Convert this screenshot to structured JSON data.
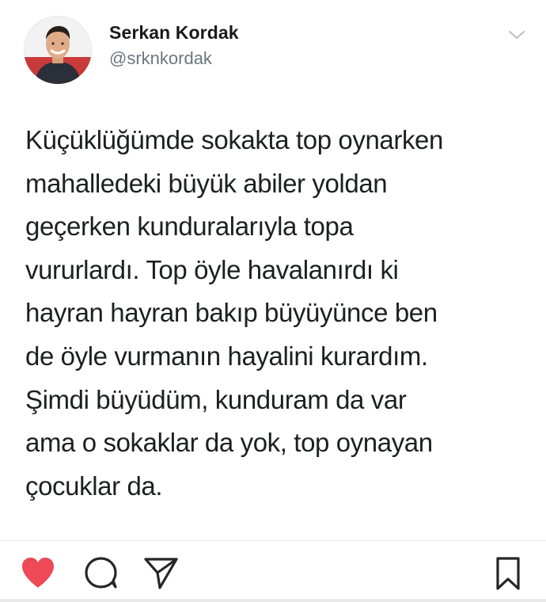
{
  "tweet": {
    "author": {
      "display_name": "Serkan Kordak",
      "handle": "@srknkordak"
    },
    "lines": [
      "Küçüklüğümde sokakta top oynarken",
      "mahalledeki büyük abiler yoldan",
      "geçerken kunduralarıyla topa",
      "vururlardı. Top öyle havalanırdı ki",
      "hayran hayran bakıp büyüyünce ben",
      "de öyle vurmanın hayalini kurardım.",
      "Şimdi büyüdüm, kunduram da var",
      "ama o sokaklar da yok, top oynayan",
      "çocuklar da."
    ]
  },
  "actions": {
    "like_icon": "heart-icon",
    "comment_icon": "comment-icon",
    "share_icon": "paper-plane-icon",
    "save_icon": "bookmark-icon",
    "like_state": "liked",
    "like_color": "#ed4956"
  },
  "colors": {
    "text": "#1d1f22",
    "handle": "#6b7680",
    "avatar_background": "#c93a3a"
  }
}
